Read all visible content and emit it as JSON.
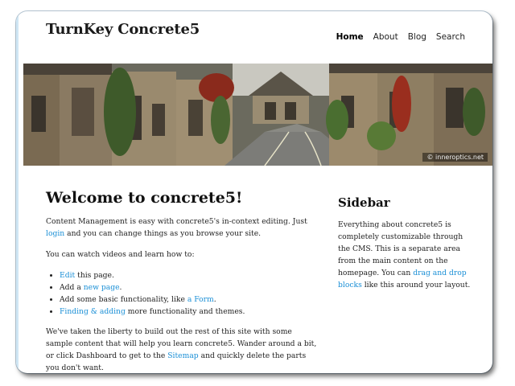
{
  "site": {
    "title": "TurnKey Concrete5"
  },
  "nav": [
    {
      "label": "Home",
      "active": true
    },
    {
      "label": "About",
      "active": false
    },
    {
      "label": "Blog",
      "active": false
    },
    {
      "label": "Search",
      "active": false
    }
  ],
  "hero": {
    "credit": "© inneroptics.net"
  },
  "main": {
    "heading": "Welcome to concrete5!",
    "p1_before": "Content Management is easy with concrete5's in-context editing. Just ",
    "p1_link": "login",
    "p1_after": " and you can change things as you browse your site.",
    "p2": "You can watch videos and learn how to:",
    "list": [
      {
        "link": "Edit",
        "before": "",
        "after": " this page."
      },
      {
        "before": "Add a ",
        "link": "new page",
        "after": "."
      },
      {
        "before": "Add some basic functionality, like ",
        "link": "a Form",
        "after": "."
      },
      {
        "link": "Finding & adding",
        "before": "",
        "after": " more functionality and themes."
      }
    ],
    "p3_before": "We've taken the liberty to build out the rest of this site with some sample content that will help you learn concrete5. Wander around a bit, or click Dashboard to get to the ",
    "p3_link": "Sitemap",
    "p3_after": " and quickly delete the parts you don't want."
  },
  "sidebar": {
    "heading": "Sidebar",
    "text_before": "Everything about concrete5 is completely customizable through the CMS. This is a separate area from the main content on the homepage. You can ",
    "link": "drag and drop blocks",
    "text_after": " like this around your layout."
  }
}
